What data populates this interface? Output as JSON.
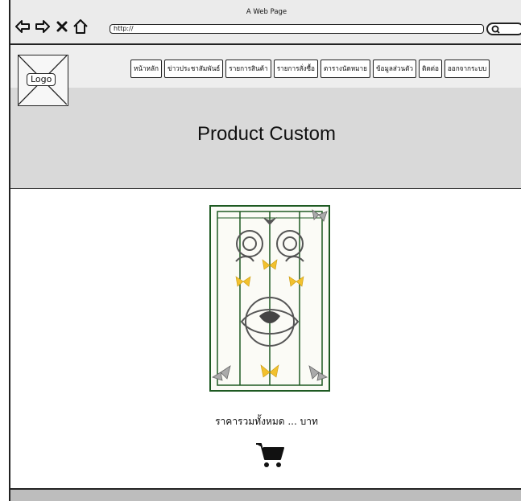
{
  "browser": {
    "title": "A Web Page",
    "url": "http://"
  },
  "header": {
    "logo_label": "Logo",
    "menu": [
      {
        "label": "หน้าหลัก"
      },
      {
        "label": "ข่าวประชาสัมพันธ์"
      },
      {
        "label": "รายการสินค้า"
      },
      {
        "label": "รายการสั่งซื้อ"
      },
      {
        "label": "ตารางนัดหมาย"
      },
      {
        "label": "ข้อมูลส่วนตัว"
      },
      {
        "label": "ติดต่อ"
      },
      {
        "label": "ออกจากระบบ"
      }
    ]
  },
  "hero": {
    "title": "Product Custom"
  },
  "product": {
    "price_text": "ราคารวมทั้งหมด ... บาท"
  },
  "colors": {
    "frame_green": "#1e5a22",
    "butterfly_yellow": "#f2c12e",
    "hero_gray": "#d9d9d9"
  }
}
